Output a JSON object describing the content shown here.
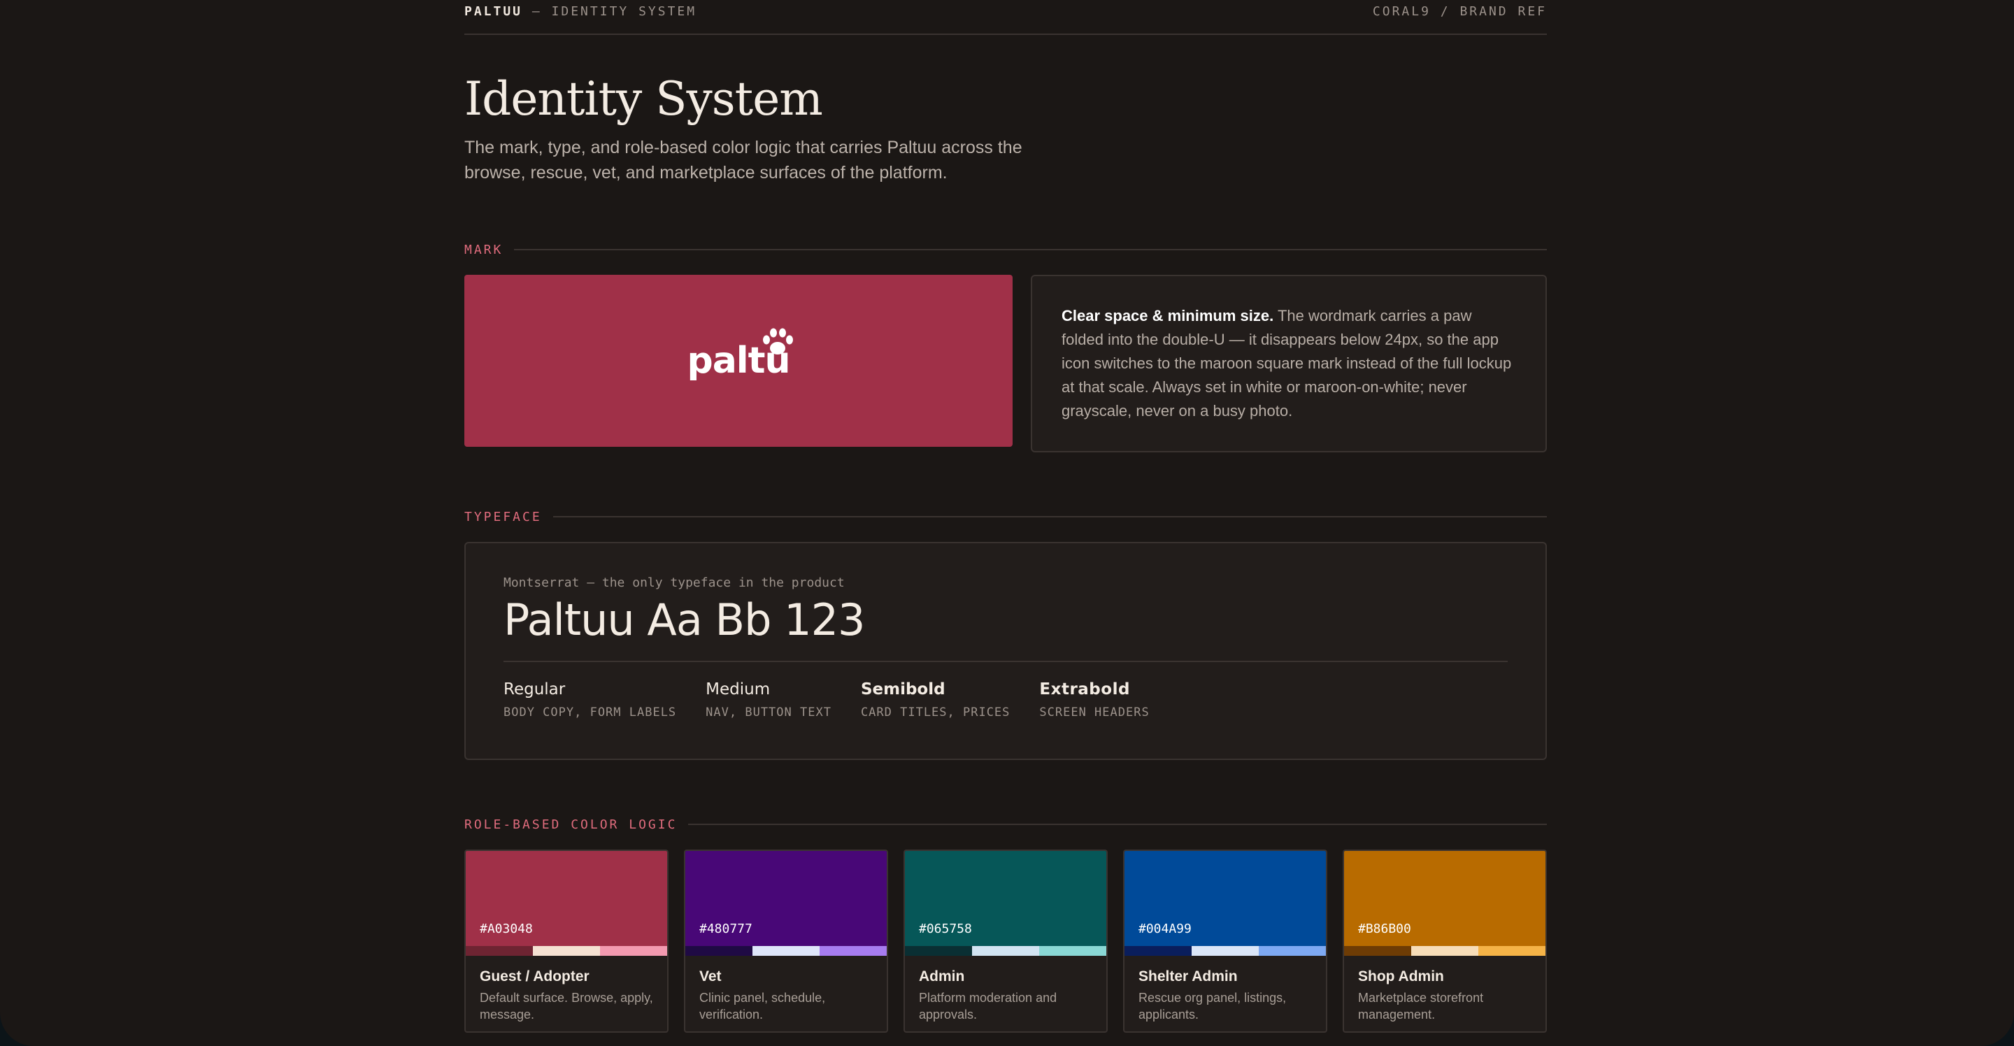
{
  "topbar": {
    "brand": "PALTUU",
    "subtitle": "— IDENTITY SYSTEM",
    "right": "CORAL9 / BRAND REF"
  },
  "header": {
    "title": "Identity System",
    "lead": "The mark, type, and role-based color logic that carries Paltuu across the browse, rescue, vet, and marketplace surfaces of the platform."
  },
  "mark": {
    "label": "MARK",
    "wordmark": "paltu",
    "wordmark_bg": "#A03048",
    "note_title": "Clear space & minimum size.",
    "note_body": " The wordmark carries a paw folded into the double-U — it disappears below 24px, so the app icon switches to the maroon square mark instead of the full lockup at that scale. Always set in white or maroon-on-white; never grayscale, never on a busy photo."
  },
  "typeface": {
    "label": "TYPEFACE",
    "caption": "Montserrat — the only typeface in the product",
    "specimen": "Paltuu Aa Bb 123",
    "weights": [
      {
        "name": "Regular",
        "use": "BODY COPY, FORM LABELS",
        "weight": "400"
      },
      {
        "name": "Medium",
        "use": "NAV, BUTTON TEXT",
        "weight": "500"
      },
      {
        "name": "Semibold",
        "use": "CARD TITLES, PRICES",
        "weight": "600"
      },
      {
        "name": "Extrabold",
        "use": "SCREEN HEADERS",
        "weight": "800"
      }
    ]
  },
  "roles": {
    "label": "ROLE-BASED COLOR LOGIC",
    "items": [
      {
        "hex": "#A03048",
        "name": "Guest / Adopter",
        "desc": "Default surface. Browse, apply, message.",
        "color": "#a03048",
        "tints": [
          "#6e2432",
          "#f5e1d2",
          "#f39ab0"
        ]
      },
      {
        "hex": "#480777",
        "name": "Vet",
        "desc": "Clinic panel, schedule, verification.",
        "color": "#480777",
        "tints": [
          "#1f0a44",
          "#dfe6fa",
          "#a77cf0"
        ]
      },
      {
        "hex": "#065758",
        "name": "Admin",
        "desc": "Platform moderation and approvals.",
        "color": "#065758",
        "tints": [
          "#0a2f33",
          "#d2e4f2",
          "#8ad8d5"
        ]
      },
      {
        "hex": "#004A99",
        "name": "Shelter Admin",
        "desc": "Rescue org panel, listings, applicants.",
        "color": "#004a99",
        "tints": [
          "#0a1e5c",
          "#dbe6f8",
          "#7ea9f2"
        ]
      },
      {
        "hex": "#B86B00",
        "name": "Shop Admin",
        "desc": "Marketplace storefront management.",
        "color": "#b86b00",
        "tints": [
          "#6e3c05",
          "#f7ddb8",
          "#f5b347"
        ]
      }
    ]
  }
}
